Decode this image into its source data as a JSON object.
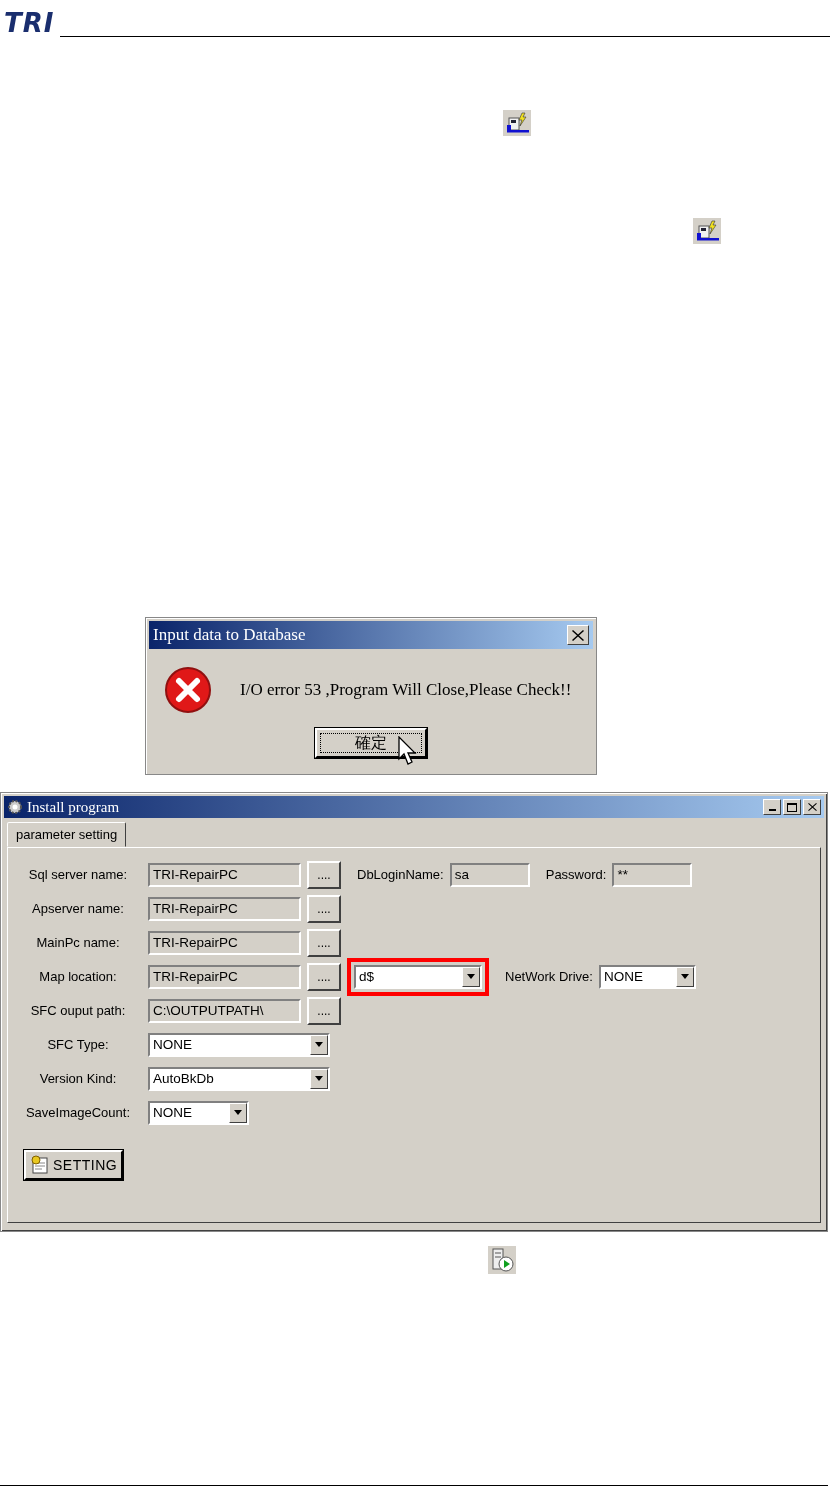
{
  "header": {
    "logo": "TRI"
  },
  "dialog": {
    "title": "Input data to Database",
    "message": "I/O error 53 ,Program Will Close,Please Check!!",
    "button": "確定"
  },
  "window": {
    "title": "Install program",
    "tabs": [
      {
        "label": "parameter setting",
        "selected": true
      }
    ],
    "rows": [
      {
        "label": "Sql server name:",
        "controls": [
          {
            "kind": "text",
            "value": "TRI-RepairPC"
          },
          {
            "kind": "browse",
            "label": "...."
          },
          {
            "kind": "caption",
            "text": "DbLoginName:"
          },
          {
            "kind": "short",
            "value": "sa"
          },
          {
            "kind": "caption",
            "text": "Password:"
          },
          {
            "kind": "short",
            "value": "**"
          }
        ]
      },
      {
        "label": "Apserver name:",
        "controls": [
          {
            "kind": "text",
            "value": "TRI-RepairPC"
          },
          {
            "kind": "browse",
            "label": "...."
          }
        ]
      },
      {
        "label": "MainPc name:",
        "controls": [
          {
            "kind": "text",
            "value": "TRI-RepairPC"
          },
          {
            "kind": "browse",
            "label": "...."
          }
        ]
      },
      {
        "label": "Map location:",
        "controls": [
          {
            "kind": "text",
            "value": "TRI-RepairPC"
          },
          {
            "kind": "browse",
            "label": "...."
          },
          {
            "kind": "combo",
            "value": "d$",
            "highlighted": true
          },
          {
            "kind": "caption",
            "text": "NetWork Drive:"
          },
          {
            "kind": "smallcombo",
            "value": "NONE"
          }
        ]
      },
      {
        "label": "SFC ouput path:",
        "controls": [
          {
            "kind": "text",
            "value": "C:\\OUTPUTPATH\\"
          },
          {
            "kind": "browse",
            "label": "...."
          }
        ]
      },
      {
        "label": "SFC Type:",
        "controls": [
          {
            "kind": "widecombo",
            "value": "NONE"
          }
        ]
      },
      {
        "label": "Version Kind:",
        "controls": [
          {
            "kind": "widecombo",
            "value": "AutoBkDb"
          }
        ]
      },
      {
        "label": "SaveImageCount:",
        "controls": [
          {
            "kind": "smallcombo",
            "value": "NONE"
          }
        ]
      }
    ],
    "button": "SETTING"
  }
}
